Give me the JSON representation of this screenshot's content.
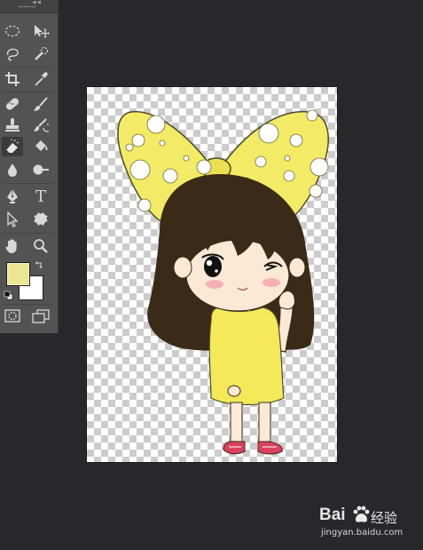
{
  "toolbar": {
    "tools": [
      {
        "name": "elliptical-marquee-tool",
        "active": false
      },
      {
        "name": "move-tool",
        "active": false
      },
      {
        "name": "lasso-tool",
        "active": false
      },
      {
        "name": "quick-selection-tool",
        "active": false
      },
      {
        "name": "crop-tool",
        "active": false
      },
      {
        "name": "eyedropper-tool",
        "active": false
      },
      {
        "name": "spot-healing-brush-tool",
        "active": false
      },
      {
        "name": "brush-tool",
        "active": false
      },
      {
        "name": "clone-stamp-tool",
        "active": false
      },
      {
        "name": "history-brush-tool",
        "active": false
      },
      {
        "name": "eraser-tool",
        "active": true
      },
      {
        "name": "paint-bucket-tool",
        "active": false
      },
      {
        "name": "blur-tool",
        "active": false
      },
      {
        "name": "dodge-tool",
        "active": false
      },
      {
        "name": "pen-tool",
        "active": false
      },
      {
        "name": "type-tool",
        "active": false
      },
      {
        "name": "path-selection-tool",
        "active": false
      },
      {
        "name": "custom-shape-tool",
        "active": false
      },
      {
        "name": "hand-tool",
        "active": false
      },
      {
        "name": "zoom-tool",
        "active": false
      },
      {
        "name": "quick-mask-mode",
        "active": false
      },
      {
        "name": "screen-mode",
        "active": false
      }
    ],
    "type_tool_glyph": "T",
    "foreground_color": "#ece592",
    "background_color": "#ffffff"
  },
  "canvas": {
    "content": "cartoon-girl-with-yellow-bow",
    "background": "transparent-checkerboard"
  },
  "watermark": {
    "brand": "Bai",
    "brand_suffix": "经验",
    "url": "jingyan.baidu.com"
  },
  "colors": {
    "workspace": "#28282a",
    "panel": "#535353",
    "accent_yellow": "#f3ea66",
    "hair": "#3a2a17"
  }
}
